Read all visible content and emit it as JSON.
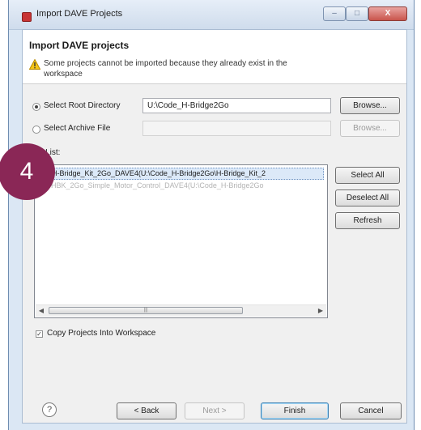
{
  "window": {
    "title": "Import DAVE Projects",
    "min_glyph": "–",
    "max_glyph": "□",
    "close_glyph": "X"
  },
  "header": {
    "title": "Import DAVE projects",
    "message": "Some projects cannot be imported because they already exist in the workspace"
  },
  "source": {
    "root_dir_label": "Select Root Directory",
    "root_dir_value": "U:\\Code_H-Bridge2Go",
    "root_browse_label": "Browse...",
    "archive_label": "Select Archive File",
    "archive_value": "",
    "archive_browse_label": "Browse..."
  },
  "projects": {
    "label": "ect List:",
    "items": [
      {
        "text": "H-Bridge_Kit_2Go_DAVE4(U:\\Code_H-Bridge2Go\\H-Bridge_Kit_2",
        "checked": true
      },
      {
        "text": "HBK_2Go_Simple_Motor_Control_DAVE4(U:\\Code_H-Bridge2Go",
        "checked": false
      }
    ],
    "check_glyph": "✓",
    "scroll_left": "◀",
    "scroll_right": "▶",
    "scroll_grip": "|||",
    "select_all_label": "Select All",
    "deselect_all_label": "Deselect All",
    "refresh_label": "Refresh"
  },
  "options": {
    "copy_label": "Copy Projects Into Workspace",
    "check_glyph": "✓"
  },
  "footer": {
    "help_glyph": "?",
    "back_label": "< Back",
    "next_label": "Next >",
    "finish_label": "Finish",
    "cancel_label": "Cancel"
  },
  "annotation": {
    "number": "4",
    "color": "#8a2756"
  }
}
